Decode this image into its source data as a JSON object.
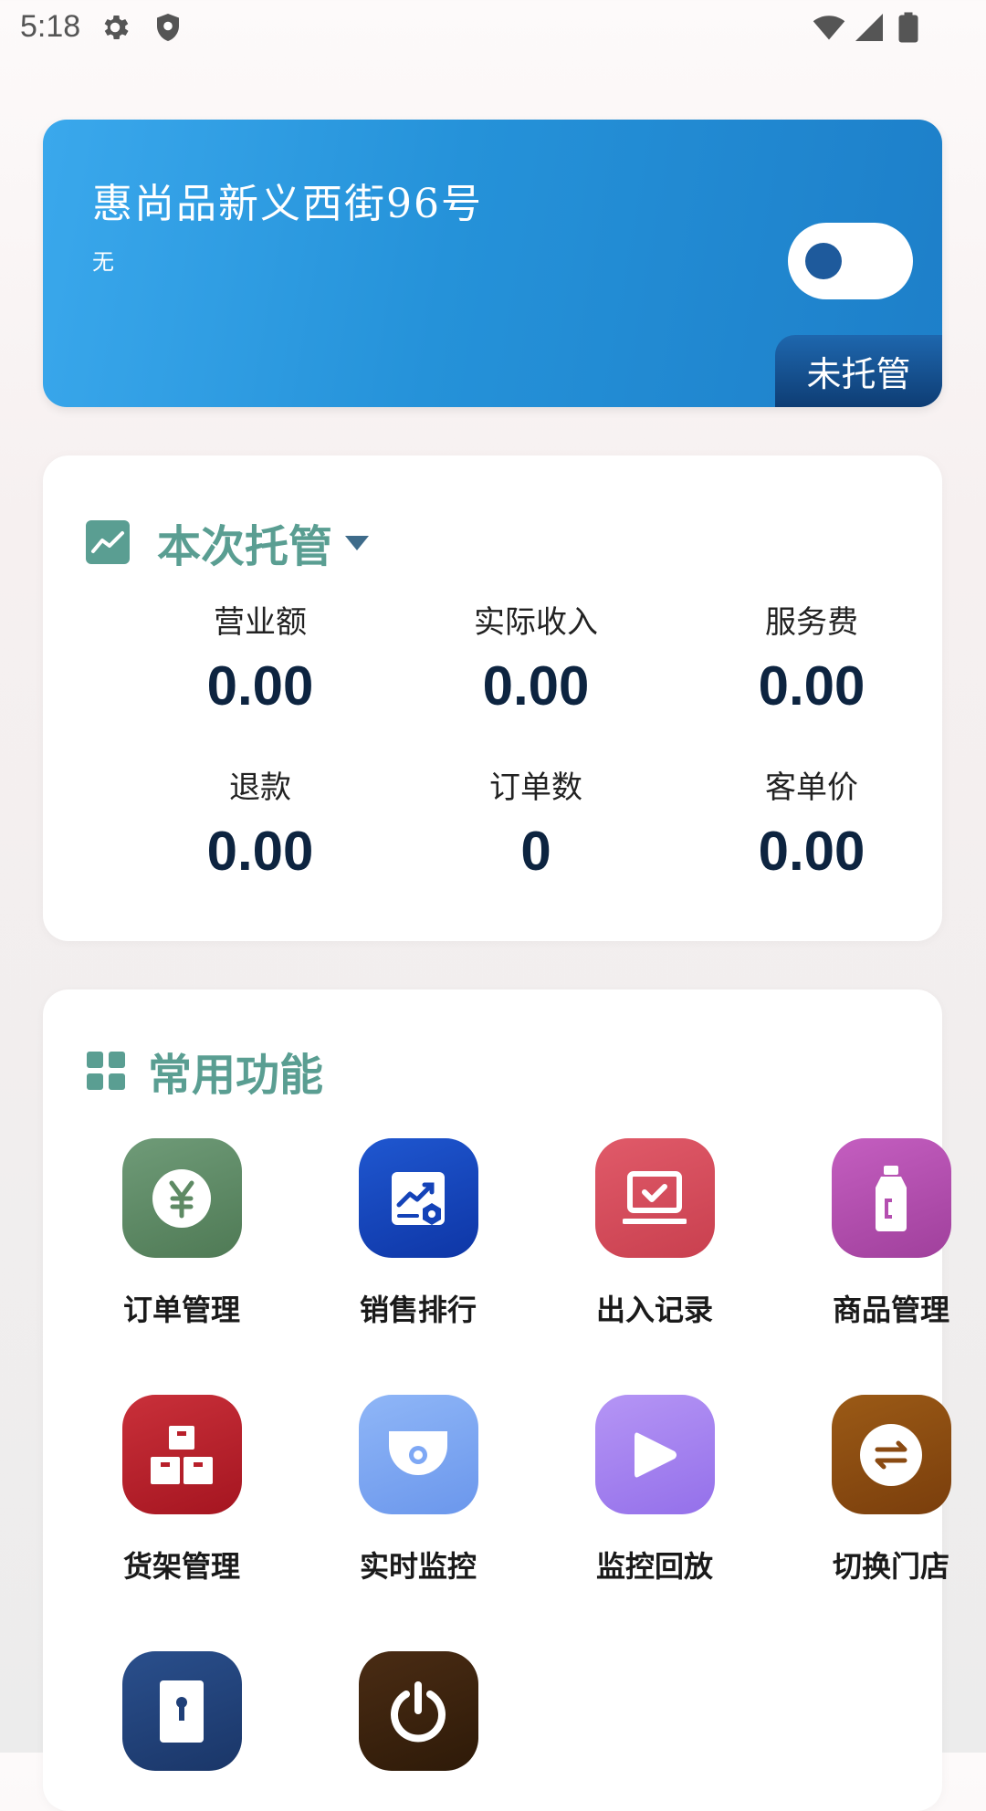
{
  "status_bar": {
    "time": "5:18"
  },
  "store": {
    "name": "惠尚品新义西街96号",
    "subtitle": "无",
    "hosting_status": "未托管",
    "toggle_on": false
  },
  "stats": {
    "title": "本次托管",
    "items": [
      {
        "label": "营业额",
        "value": "0.00"
      },
      {
        "label": "实际收入",
        "value": "0.00"
      },
      {
        "label": "服务费",
        "value": "0.00"
      },
      {
        "label": "退款",
        "value": "0.00"
      },
      {
        "label": "订单数",
        "value": "0"
      },
      {
        "label": "客单价",
        "value": "0.00"
      }
    ]
  },
  "functions": {
    "title": "常用功能",
    "items": [
      {
        "label": "订单管理",
        "icon": "yuan-icon",
        "color": "#5e8a64"
      },
      {
        "label": "销售排行",
        "icon": "chart-icon",
        "color": "#1443b8"
      },
      {
        "label": "出入记录",
        "icon": "laptop-check-icon",
        "color": "#d8505f"
      },
      {
        "label": "商品管理",
        "icon": "bottle-icon",
        "color": "#b44fb0"
      },
      {
        "label": "货架管理",
        "icon": "boxes-icon",
        "color": "#b81f2a"
      },
      {
        "label": "实时监控",
        "icon": "camera-icon",
        "color": "#7ea8f5"
      },
      {
        "label": "监控回放",
        "icon": "play-icon",
        "color": "#a982f2"
      },
      {
        "label": "切换门店",
        "icon": "switch-icon",
        "color": "#8a4a12"
      },
      {
        "label": "",
        "icon": "door-icon",
        "color": "#1f3f78"
      },
      {
        "label": "",
        "icon": "power-icon",
        "color": "#3d2310"
      }
    ]
  }
}
